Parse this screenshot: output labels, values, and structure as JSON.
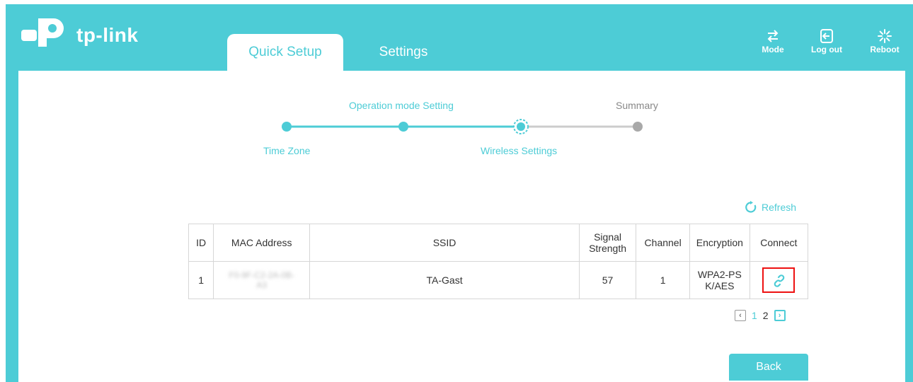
{
  "brand": {
    "name": "tp-link"
  },
  "tabs": [
    {
      "label": "Quick Setup",
      "active": true
    },
    {
      "label": "Settings",
      "active": false
    }
  ],
  "toolbar": {
    "mode_label": "Mode",
    "logout_label": "Log out",
    "reboot_label": "Reboot"
  },
  "steps": [
    {
      "label": "Time Zone",
      "state": "done"
    },
    {
      "label": "Operation mode Setting",
      "state": "done"
    },
    {
      "label": "Wireless Settings",
      "state": "current"
    },
    {
      "label": "Summary",
      "state": "pending"
    }
  ],
  "refresh_label": "Refresh",
  "table": {
    "headers": [
      "ID",
      "MAC Address",
      "SSID",
      "Signal Strength",
      "Channel",
      "Encryption",
      "Connect"
    ],
    "signal_header_line1": "Signal",
    "signal_header_line2": "Strength",
    "rows": [
      {
        "id": "1",
        "mac_line1": "F0-9F-C2-2A-0B-",
        "mac_line2": "A3",
        "ssid": "TA-Gast",
        "signal": "57",
        "channel": "1",
        "encryption_line1": "WPA2-PS",
        "encryption_line2": "K/AES"
      }
    ]
  },
  "pagination": {
    "pages": [
      "1",
      "2"
    ],
    "current": "1"
  },
  "back_label": "Back",
  "colors": {
    "accent": "#4dccd6",
    "highlight": "#e11111",
    "pending": "#bbbbbb"
  }
}
